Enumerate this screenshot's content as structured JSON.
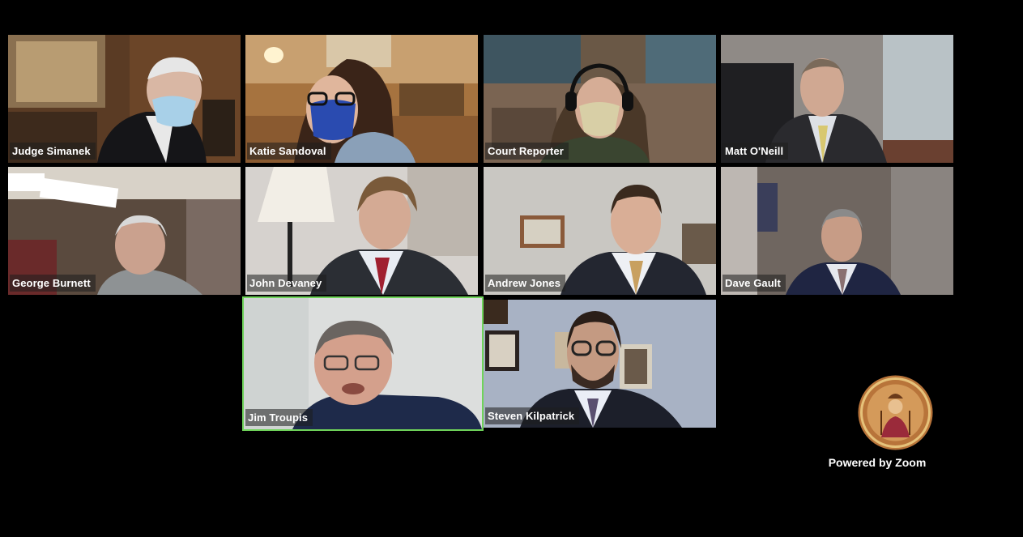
{
  "meeting": {
    "participants": [
      {
        "name": "Judge Simanek"
      },
      {
        "name": "Katie Sandoval"
      },
      {
        "name": "Court Reporter"
      },
      {
        "name": "Matt O'Neill"
      },
      {
        "name": "George Burnett"
      },
      {
        "name": "John Devaney"
      },
      {
        "name": "Andrew Jones"
      },
      {
        "name": "Dave Gault"
      },
      {
        "name": "Jim Troupis",
        "active_speaker": true
      },
      {
        "name": "Steven Kilpatrick"
      }
    ],
    "active_speaker_color": "#6fd35a"
  },
  "branding": {
    "powered_by": "Powered by Zoom",
    "seal_icon": "court-seal-icon"
  }
}
